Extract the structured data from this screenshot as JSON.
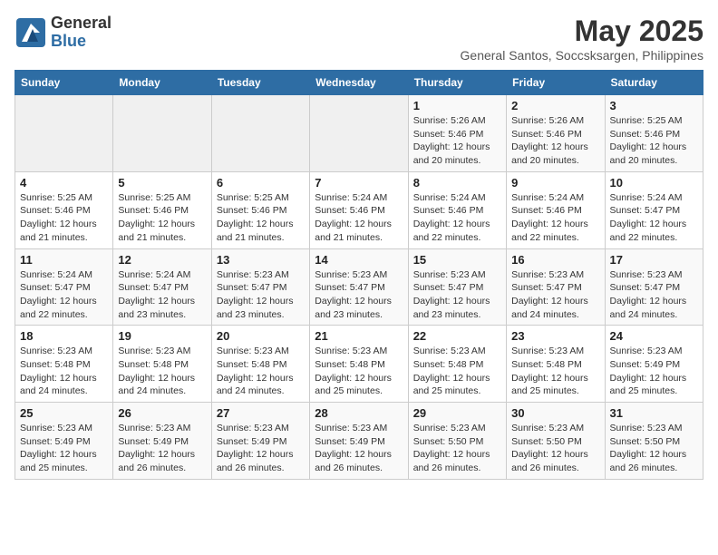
{
  "logo": {
    "general": "General",
    "blue": "Blue"
  },
  "title": "May 2025",
  "location": "General Santos, Soccsksargen, Philippines",
  "days_of_week": [
    "Sunday",
    "Monday",
    "Tuesday",
    "Wednesday",
    "Thursday",
    "Friday",
    "Saturday"
  ],
  "weeks": [
    [
      {
        "day": "",
        "info": ""
      },
      {
        "day": "",
        "info": ""
      },
      {
        "day": "",
        "info": ""
      },
      {
        "day": "",
        "info": ""
      },
      {
        "day": "1",
        "info": "Sunrise: 5:26 AM\nSunset: 5:46 PM\nDaylight: 12 hours\nand 20 minutes."
      },
      {
        "day": "2",
        "info": "Sunrise: 5:26 AM\nSunset: 5:46 PM\nDaylight: 12 hours\nand 20 minutes."
      },
      {
        "day": "3",
        "info": "Sunrise: 5:25 AM\nSunset: 5:46 PM\nDaylight: 12 hours\nand 20 minutes."
      }
    ],
    [
      {
        "day": "4",
        "info": "Sunrise: 5:25 AM\nSunset: 5:46 PM\nDaylight: 12 hours\nand 21 minutes."
      },
      {
        "day": "5",
        "info": "Sunrise: 5:25 AM\nSunset: 5:46 PM\nDaylight: 12 hours\nand 21 minutes."
      },
      {
        "day": "6",
        "info": "Sunrise: 5:25 AM\nSunset: 5:46 PM\nDaylight: 12 hours\nand 21 minutes."
      },
      {
        "day": "7",
        "info": "Sunrise: 5:24 AM\nSunset: 5:46 PM\nDaylight: 12 hours\nand 21 minutes."
      },
      {
        "day": "8",
        "info": "Sunrise: 5:24 AM\nSunset: 5:46 PM\nDaylight: 12 hours\nand 22 minutes."
      },
      {
        "day": "9",
        "info": "Sunrise: 5:24 AM\nSunset: 5:46 PM\nDaylight: 12 hours\nand 22 minutes."
      },
      {
        "day": "10",
        "info": "Sunrise: 5:24 AM\nSunset: 5:47 PM\nDaylight: 12 hours\nand 22 minutes."
      }
    ],
    [
      {
        "day": "11",
        "info": "Sunrise: 5:24 AM\nSunset: 5:47 PM\nDaylight: 12 hours\nand 22 minutes."
      },
      {
        "day": "12",
        "info": "Sunrise: 5:24 AM\nSunset: 5:47 PM\nDaylight: 12 hours\nand 23 minutes."
      },
      {
        "day": "13",
        "info": "Sunrise: 5:23 AM\nSunset: 5:47 PM\nDaylight: 12 hours\nand 23 minutes."
      },
      {
        "day": "14",
        "info": "Sunrise: 5:23 AM\nSunset: 5:47 PM\nDaylight: 12 hours\nand 23 minutes."
      },
      {
        "day": "15",
        "info": "Sunrise: 5:23 AM\nSunset: 5:47 PM\nDaylight: 12 hours\nand 23 minutes."
      },
      {
        "day": "16",
        "info": "Sunrise: 5:23 AM\nSunset: 5:47 PM\nDaylight: 12 hours\nand 24 minutes."
      },
      {
        "day": "17",
        "info": "Sunrise: 5:23 AM\nSunset: 5:47 PM\nDaylight: 12 hours\nand 24 minutes."
      }
    ],
    [
      {
        "day": "18",
        "info": "Sunrise: 5:23 AM\nSunset: 5:48 PM\nDaylight: 12 hours\nand 24 minutes."
      },
      {
        "day": "19",
        "info": "Sunrise: 5:23 AM\nSunset: 5:48 PM\nDaylight: 12 hours\nand 24 minutes."
      },
      {
        "day": "20",
        "info": "Sunrise: 5:23 AM\nSunset: 5:48 PM\nDaylight: 12 hours\nand 24 minutes."
      },
      {
        "day": "21",
        "info": "Sunrise: 5:23 AM\nSunset: 5:48 PM\nDaylight: 12 hours\nand 25 minutes."
      },
      {
        "day": "22",
        "info": "Sunrise: 5:23 AM\nSunset: 5:48 PM\nDaylight: 12 hours\nand 25 minutes."
      },
      {
        "day": "23",
        "info": "Sunrise: 5:23 AM\nSunset: 5:48 PM\nDaylight: 12 hours\nand 25 minutes."
      },
      {
        "day": "24",
        "info": "Sunrise: 5:23 AM\nSunset: 5:49 PM\nDaylight: 12 hours\nand 25 minutes."
      }
    ],
    [
      {
        "day": "25",
        "info": "Sunrise: 5:23 AM\nSunset: 5:49 PM\nDaylight: 12 hours\nand 25 minutes."
      },
      {
        "day": "26",
        "info": "Sunrise: 5:23 AM\nSunset: 5:49 PM\nDaylight: 12 hours\nand 26 minutes."
      },
      {
        "day": "27",
        "info": "Sunrise: 5:23 AM\nSunset: 5:49 PM\nDaylight: 12 hours\nand 26 minutes."
      },
      {
        "day": "28",
        "info": "Sunrise: 5:23 AM\nSunset: 5:49 PM\nDaylight: 12 hours\nand 26 minutes."
      },
      {
        "day": "29",
        "info": "Sunrise: 5:23 AM\nSunset: 5:50 PM\nDaylight: 12 hours\nand 26 minutes."
      },
      {
        "day": "30",
        "info": "Sunrise: 5:23 AM\nSunset: 5:50 PM\nDaylight: 12 hours\nand 26 minutes."
      },
      {
        "day": "31",
        "info": "Sunrise: 5:23 AM\nSunset: 5:50 PM\nDaylight: 12 hours\nand 26 minutes."
      }
    ]
  ]
}
